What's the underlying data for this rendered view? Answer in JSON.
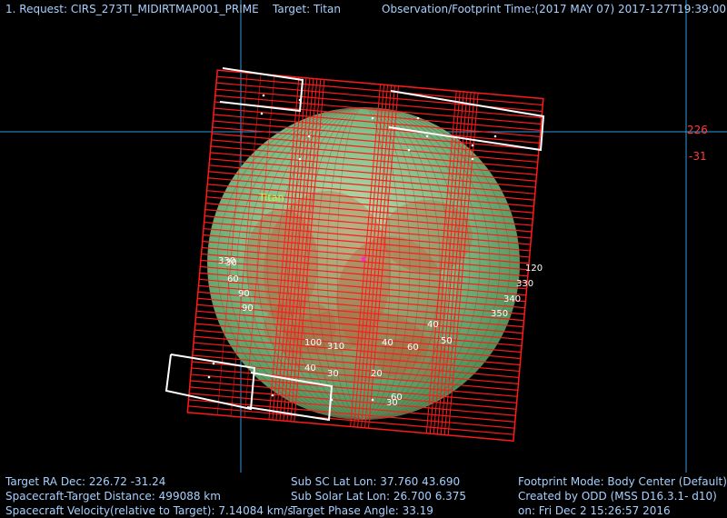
{
  "header": {
    "request": "1. Request: CIRS_273TI_MIDIRTMAP001_PRIME",
    "target": "Target: Titan",
    "obs_time": "Observation/Footprint Time:(2017 MAY 07) 2017-127T19:39:00.75"
  },
  "axis_labels": {
    "ra": "226",
    "dec": "-31"
  },
  "target_label": "Titan",
  "footer": {
    "col1": [
      "Target RA Dec: 226.72  -31.24",
      "Spacecraft-Target Distance:  499088 km",
      "Spacecraft Velocity(relative to Target): 7.14084 km/s"
    ],
    "col2": [
      "Sub SC Lat Lon: 37.760  43.690",
      "Sub Solar Lat Lon: 26.700   6.375",
      "Target Phase Angle: 33.19"
    ],
    "col3": [
      "Footprint Mode: Body Center (Default)",
      "Created by ODD (MSS D16.3.1- d10)",
      "on: Fri Dec  2 15:26:57 2016"
    ]
  },
  "grid_labels": [
    "120",
    "330",
    "340",
    "350",
    "30",
    "60",
    "90",
    "90",
    "330",
    "310",
    "100",
    "40",
    "60",
    "50",
    "60",
    "30",
    "40",
    "30",
    "20",
    "40"
  ],
  "colors": {
    "background": "#000000",
    "crosshair": "#2f9ae0",
    "footprint": "#ff1a1a",
    "planet": "#7fd88a",
    "boundary": "#ffffff",
    "text": "#a8d0ff"
  }
}
